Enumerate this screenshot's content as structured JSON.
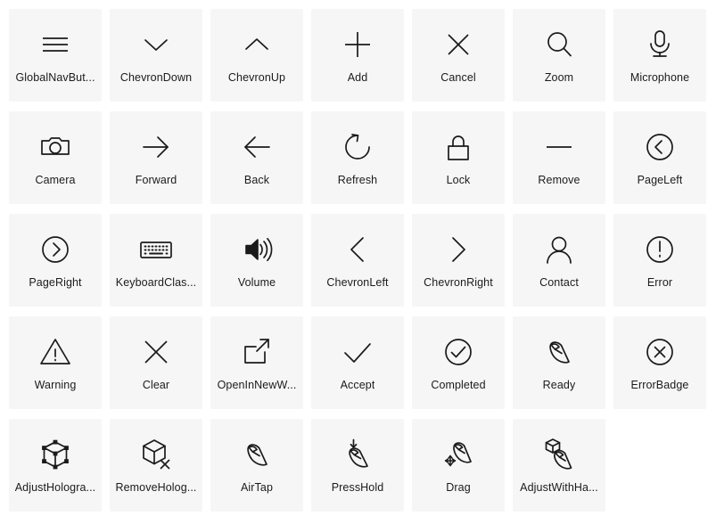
{
  "page": {
    "background_color": "#ffffff",
    "tile_color": "#f6f6f6",
    "icon_color": "#1b1b1b",
    "label_color": "#1b1b1b",
    "columns": 7,
    "rows": 5
  },
  "icons": [
    {
      "icon": "global-nav-button-icon",
      "label": "GlobalNavBut...",
      "full_label": "GlobalNavButton"
    },
    {
      "icon": "chevron-down-icon",
      "label": "ChevronDown",
      "full_label": "ChevronDown"
    },
    {
      "icon": "chevron-up-icon",
      "label": "ChevronUp",
      "full_label": "ChevronUp"
    },
    {
      "icon": "add-icon",
      "label": "Add",
      "full_label": "Add"
    },
    {
      "icon": "cancel-icon",
      "label": "Cancel",
      "full_label": "Cancel"
    },
    {
      "icon": "zoom-icon",
      "label": "Zoom",
      "full_label": "Zoom"
    },
    {
      "icon": "microphone-icon",
      "label": "Microphone",
      "full_label": "Microphone"
    },
    {
      "icon": "camera-icon",
      "label": "Camera",
      "full_label": "Camera"
    },
    {
      "icon": "forward-icon",
      "label": "Forward",
      "full_label": "Forward"
    },
    {
      "icon": "back-icon",
      "label": "Back",
      "full_label": "Back"
    },
    {
      "icon": "refresh-icon",
      "label": "Refresh",
      "full_label": "Refresh"
    },
    {
      "icon": "lock-icon",
      "label": "Lock",
      "full_label": "Lock"
    },
    {
      "icon": "remove-icon",
      "label": "Remove",
      "full_label": "Remove"
    },
    {
      "icon": "page-left-icon",
      "label": "PageLeft",
      "full_label": "PageLeft"
    },
    {
      "icon": "page-right-icon",
      "label": "PageRight",
      "full_label": "PageRight"
    },
    {
      "icon": "keyboard-classic-icon",
      "label": "KeyboardClas...",
      "full_label": "KeyboardClassic"
    },
    {
      "icon": "volume-icon",
      "label": "Volume",
      "full_label": "Volume"
    },
    {
      "icon": "chevron-left-icon",
      "label": "ChevronLeft",
      "full_label": "ChevronLeft"
    },
    {
      "icon": "chevron-right-icon",
      "label": "ChevronRight",
      "full_label": "ChevronRight"
    },
    {
      "icon": "contact-icon",
      "label": "Contact",
      "full_label": "Contact"
    },
    {
      "icon": "error-icon",
      "label": "Error",
      "full_label": "Error"
    },
    {
      "icon": "warning-icon",
      "label": "Warning",
      "full_label": "Warning"
    },
    {
      "icon": "clear-icon",
      "label": "Clear",
      "full_label": "Clear"
    },
    {
      "icon": "open-in-new-window-icon",
      "label": "OpenInNewW...",
      "full_label": "OpenInNewWindow"
    },
    {
      "icon": "accept-icon",
      "label": "Accept",
      "full_label": "Accept"
    },
    {
      "icon": "completed-icon",
      "label": "Completed",
      "full_label": "Completed"
    },
    {
      "icon": "ready-icon",
      "label": "Ready",
      "full_label": "Ready"
    },
    {
      "icon": "error-badge-icon",
      "label": "ErrorBadge",
      "full_label": "ErrorBadge"
    },
    {
      "icon": "adjust-hologram-icon",
      "label": "AdjustHologra...",
      "full_label": "AdjustHologram"
    },
    {
      "icon": "remove-hologram-icon",
      "label": "RemoveHolog...",
      "full_label": "RemoveHologram"
    },
    {
      "icon": "air-tap-icon",
      "label": "AirTap",
      "full_label": "AirTap"
    },
    {
      "icon": "press-hold-icon",
      "label": "PressHold",
      "full_label": "PressHold"
    },
    {
      "icon": "drag-icon",
      "label": "Drag",
      "full_label": "Drag"
    },
    {
      "icon": "adjust-with-hand-icon",
      "label": "AdjustWithHa...",
      "full_label": "AdjustWithHand"
    }
  ]
}
